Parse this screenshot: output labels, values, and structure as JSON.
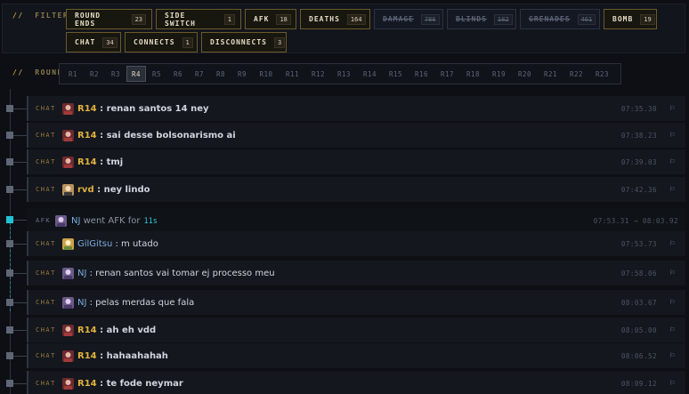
{
  "filter": {
    "label_slashes": "//",
    "label": "FILTER",
    "chips": [
      {
        "label": "ROUND ENDS",
        "count": "23",
        "on": true
      },
      {
        "label": "SIDE SWITCH",
        "count": "1",
        "on": true
      },
      {
        "label": "AFK",
        "count": "18",
        "on": true
      },
      {
        "label": "DEATHS",
        "count": "164",
        "on": true
      },
      {
        "label": "DAMAGE",
        "count": "786",
        "on": false
      },
      {
        "label": "BLINDS",
        "count": "182",
        "on": false
      },
      {
        "label": "GRENADES",
        "count": "461",
        "on": false
      },
      {
        "label": "BOMB",
        "count": "19",
        "on": true
      },
      {
        "label": "CHAT",
        "count": "34",
        "on": true
      },
      {
        "label": "CONNECTS",
        "count": "1",
        "on": true
      },
      {
        "label": "DISCONNECTS",
        "count": "3",
        "on": true
      }
    ]
  },
  "round": {
    "label_slashes": "//",
    "label": "ROUND",
    "active": "R4",
    "tabs": [
      "R1",
      "R2",
      "R3",
      "R4",
      "R5",
      "R6",
      "R7",
      "R8",
      "R9",
      "R10",
      "R11",
      "R12",
      "R13",
      "R14",
      "R15",
      "R16",
      "R17",
      "R18",
      "R19",
      "R20",
      "R21",
      "R22",
      "R23"
    ]
  },
  "events": [
    {
      "type": "CHAT",
      "player": "R14",
      "text": ": renan santos 14 ney",
      "time": "07:35.30"
    },
    {
      "type": "CHAT",
      "player": "R14",
      "text": ": sai desse bolsonarismo ai",
      "time": "07:38.23"
    },
    {
      "type": "CHAT",
      "player": "R14",
      "text": ": tmj",
      "time": "07:39.03"
    },
    {
      "type": "CHAT",
      "player": "rvd",
      "text": ": ney lindo",
      "time": "07:42.36"
    },
    {
      "type": "AFK",
      "player": "NJ",
      "text": "went AFK for",
      "duration": "11s",
      "time": "07:53.31 → 08:03.92"
    },
    {
      "type": "CHAT",
      "player": "GilGitsu",
      "text": ": m utado",
      "time": "07:53.73"
    },
    {
      "type": "CHAT",
      "player": "NJ",
      "text": ": renan santos vai tomar ej processo meu",
      "time": "07:58.06"
    },
    {
      "type": "CHAT",
      "player": "NJ",
      "text": ": pelas merdas que fala",
      "time": "08:03.67"
    },
    {
      "type": "CHAT",
      "player": "R14",
      "text": ": ah eh vdd",
      "time": "08:05.00"
    },
    {
      "type": "CHAT",
      "player": "R14",
      "text": ": hahaahahah",
      "time": "08:06.52"
    },
    {
      "type": "CHAT",
      "player": "R14",
      "text": ": te fode neymar",
      "time": "08:09.12"
    }
  ],
  "icons": {
    "flag": "flag-icon",
    "avatar": "player-avatar-icon"
  },
  "colors": {
    "accent": "#c9a24c",
    "team_t": "#e0b13c",
    "team_ct": "#7aaee0",
    "afk": "#22c3d8"
  }
}
